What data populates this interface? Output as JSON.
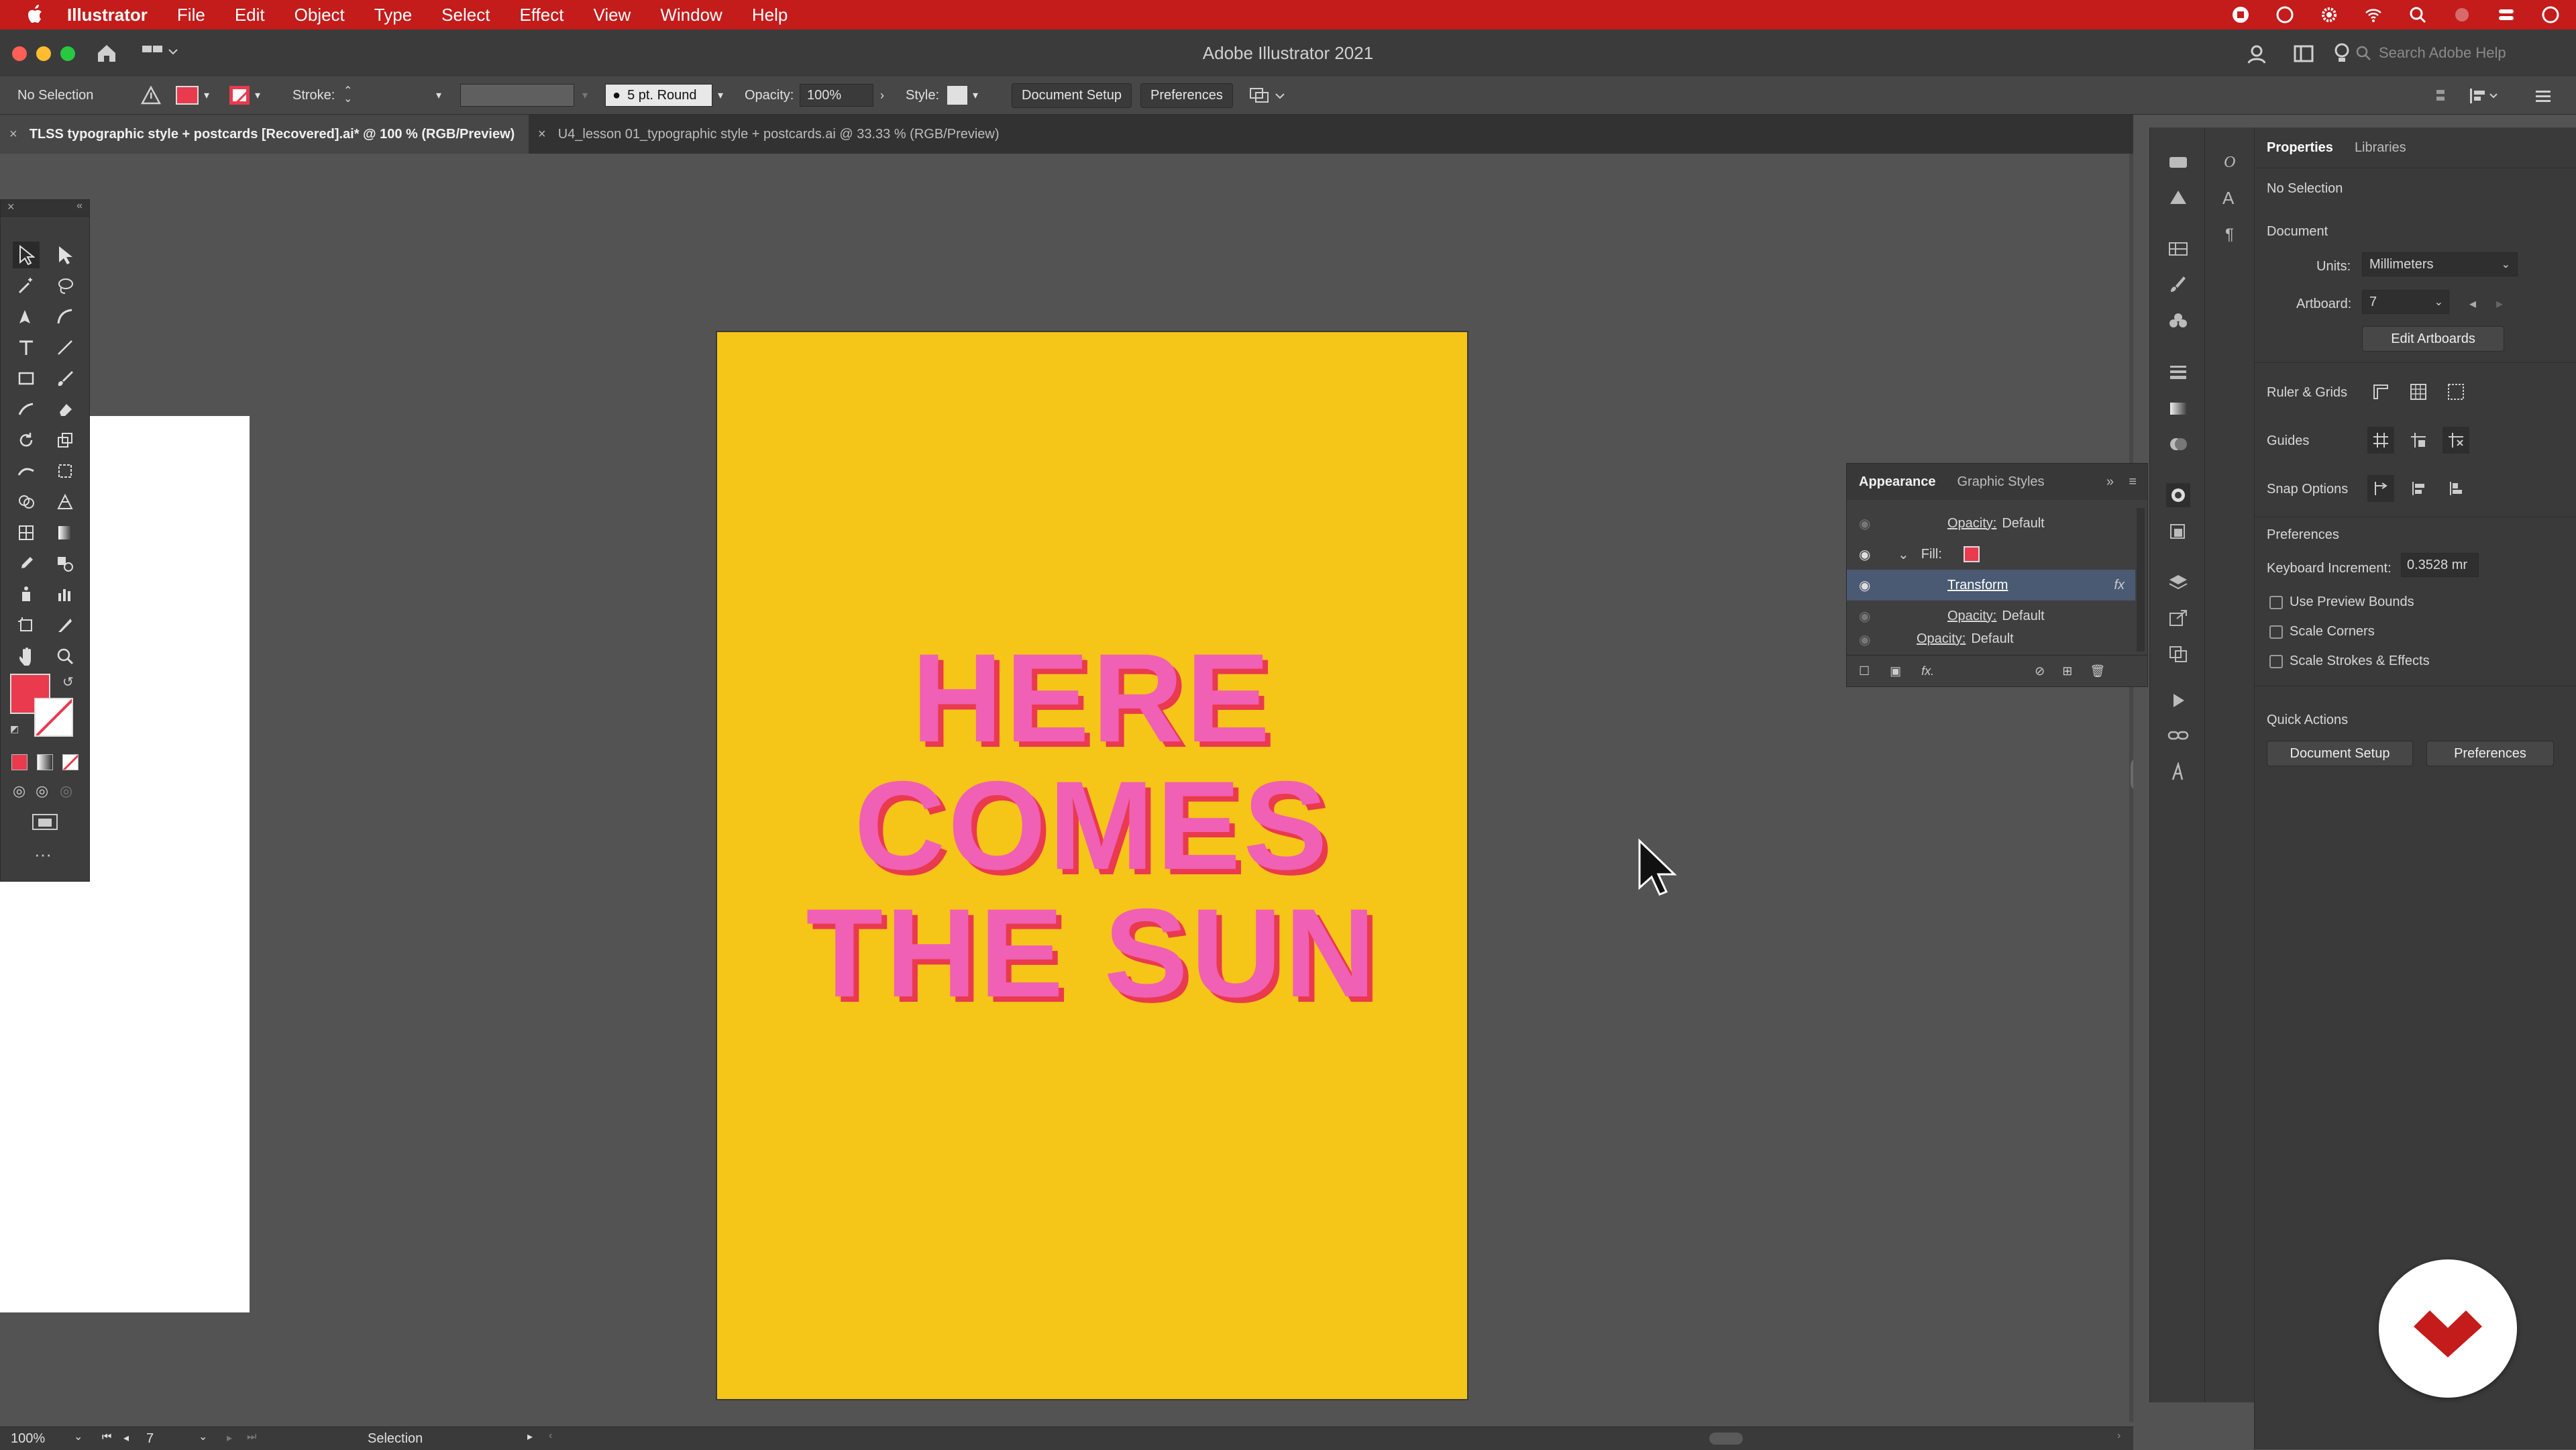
{
  "menubar": {
    "app_name": "Illustrator",
    "items": [
      "File",
      "Edit",
      "Object",
      "Type",
      "Select",
      "Effect",
      "View",
      "Window",
      "Help"
    ]
  },
  "window": {
    "title": "Adobe Illustrator 2021",
    "search_placeholder": "Search Adobe Help"
  },
  "control_bar": {
    "selection_label": "No Selection",
    "stroke_label": "Stroke:",
    "brush_value": "5 pt. Round",
    "opacity_label": "Opacity:",
    "opacity_value": "100%",
    "style_label": "Style:",
    "document_setup_label": "Document Setup",
    "preferences_label": "Preferences"
  },
  "tabs": [
    {
      "label": "TLSS typographic style + postcards [Recovered].ai* @ 100 % (RGB/Preview)",
      "active": true
    },
    {
      "label": "U4_lesson 01_typographic style + postcards.ai @ 33.33 % (RGB/Preview)",
      "active": false
    }
  ],
  "artboard": {
    "line1": "HERE",
    "line2": "COMES",
    "line3": "THE SUN",
    "background_color": "#f5c518",
    "text_color": "#f060b4",
    "shadow_color": "#e93a4e"
  },
  "appearance_panel": {
    "tab_appearance": "Appearance",
    "tab_graphic_styles": "Graphic Styles",
    "rows": {
      "r1_label": "Opacity:",
      "r1_value": "Default",
      "fill_label": "Fill:",
      "transform_label": "Transform",
      "fx_label": "fx",
      "r4_label": "Opacity:",
      "r4_value": "Default",
      "r5_label": "Opacity:",
      "r5_value": "Default"
    },
    "fill_color": "#e93a4e"
  },
  "properties": {
    "tab_properties": "Properties",
    "tab_libraries": "Libraries",
    "no_selection": "No Selection",
    "document_heading": "Document",
    "units_label": "Units:",
    "units_value": "Millimeters",
    "artboard_label": "Artboard:",
    "artboard_value": "7",
    "edit_artboards_label": "Edit Artboards",
    "ruler_grids_label": "Ruler & Grids",
    "guides_label": "Guides",
    "snap_options_label": "Snap Options",
    "preferences_heading": "Preferences",
    "keyboard_increment_label": "Keyboard Increment:",
    "keyboard_increment_value": "0.3528 mr",
    "use_preview_bounds": "Use Preview Bounds",
    "scale_corners": "Scale Corners",
    "scale_strokes": "Scale Strokes & Effects",
    "quick_actions_heading": "Quick Actions",
    "document_setup_label": "Document Setup",
    "preferences_label": "Preferences"
  },
  "status_bar": {
    "zoom": "100%",
    "artboard_number": "7",
    "tool_name": "Selection"
  },
  "colors": {
    "menubar": "#c41b1b",
    "fill_swatch": "#e93a4e",
    "selection_highlight": "#4a5a73"
  }
}
